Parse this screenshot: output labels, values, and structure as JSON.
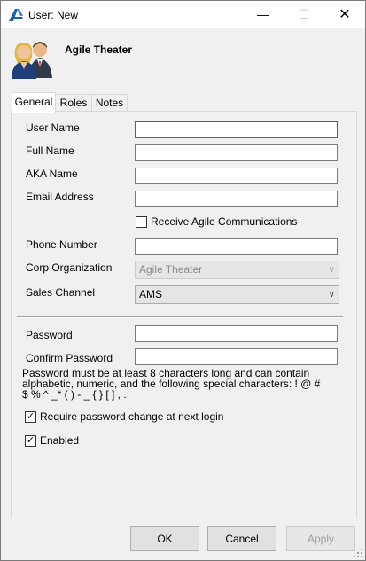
{
  "window": {
    "title": "User: New"
  },
  "header": {
    "title": "Agile Theater"
  },
  "tabs": [
    {
      "label": "General"
    },
    {
      "label": "Roles"
    },
    {
      "label": "Notes"
    }
  ],
  "form": {
    "user_name_label": "User Name",
    "full_name_label": "Full Name",
    "aka_name_label": "AKA Name",
    "email_label": "Email Address",
    "receive_comms_label": "Receive Agile Communications",
    "phone_label": "Phone Number",
    "corp_org_label": "Corp Organization",
    "corp_org_value": "Agile Theater",
    "sales_channel_label": "Sales Channel",
    "sales_channel_value": "AMS",
    "password_label": "Password",
    "confirm_password_label": "Confirm Password",
    "password_note": "Password must be at least 8 characters long and can contain alphabetic, numeric, and the following special characters:  ! @ # $ % ^ _* ( ) - _ { } [ ] , .",
    "require_change_label": "Require password change at next login",
    "require_change_checked": true,
    "enabled_label": "Enabled",
    "enabled_checked": true,
    "receive_comms_checked": false
  },
  "buttons": {
    "ok": "OK",
    "cancel": "Cancel",
    "apply": "Apply"
  }
}
